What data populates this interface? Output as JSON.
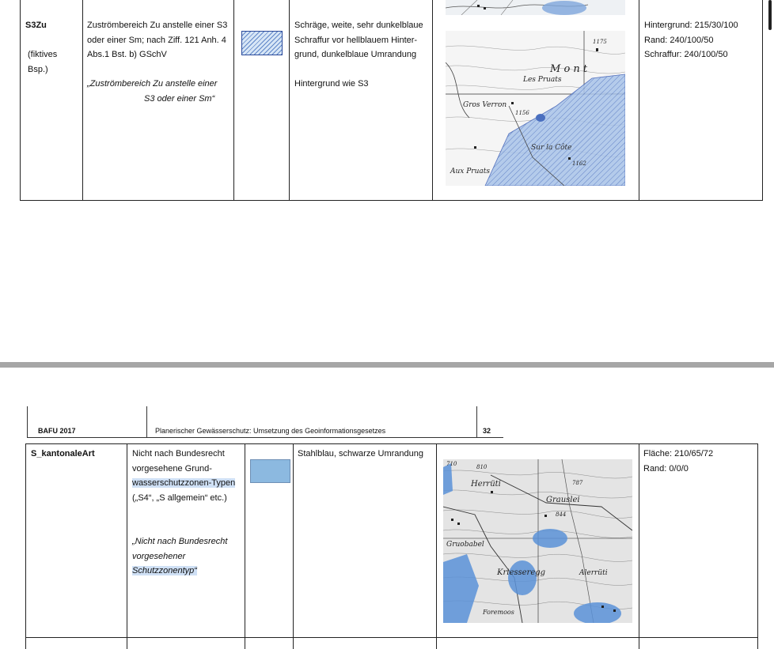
{
  "top_row": {
    "code": "S3Zu",
    "code_note": "(fiktives Bsp.)",
    "definition_lines": [
      "Zuströmbereich Zu anstelle einer S3",
      "oder einer Sm; nach Ziff. 121 Anh. 4",
      "Abs.1 Bst. b) GSchV"
    ],
    "quote_line1": "„Zuströmbereich Zu anstelle einer",
    "quote_line2": "S3 oder einer Sm“",
    "description_lines": [
      "Schräge, weite, sehr dunkelblaue",
      "Schraffur vor hellblauem Hinter-",
      "grund, dunkelblaue Umrandung"
    ],
    "description_extra": "Hintergrund wie S3",
    "colors": [
      "Hintergrund: 215/30/100",
      "Rand: 240/100/50",
      "Schraffur: 240/100/50"
    ],
    "map_labels": [
      "M o n t",
      "Les Pruats",
      "Gros Verron",
      "Sur la Côte",
      "Aux Pruats",
      "1175",
      "1156",
      "1162"
    ]
  },
  "page_header": {
    "org": "BAFU 2017",
    "title": "Planerischer Gewässerschutz: Umsetzung des Geoinformationsgesetzes",
    "page_number": "32"
  },
  "bottom_row": {
    "code": "S_kantonaleArt",
    "definition_lines": [
      "Nicht nach Bundesrecht",
      "vorgesehene Grund-",
      "wasserschutzzonen-Typen",
      "(„S4“, „S allgemein“ etc.)"
    ],
    "quote_lines": [
      "„Nicht nach Bundesrecht",
      "vorgesehener",
      "Schutzzonentyp“"
    ],
    "description": "Stahlblau, schwarze Umrandung",
    "colors": [
      "Fläche: 210/65/72",
      "Rand: 0/0/0"
    ],
    "map_labels": [
      "Herrüti",
      "Grauslei",
      "Gruobabel",
      "Kriesseregg",
      "Alerrüti",
      "Foremoos",
      "810",
      "787",
      "844",
      "710"
    ]
  },
  "accent_colors": {
    "hatch_bg": "#d7e6f6",
    "hatch_line": "#5f86c8",
    "steel_blue": "#8cb9e0",
    "divider": "#a6a6a6"
  }
}
